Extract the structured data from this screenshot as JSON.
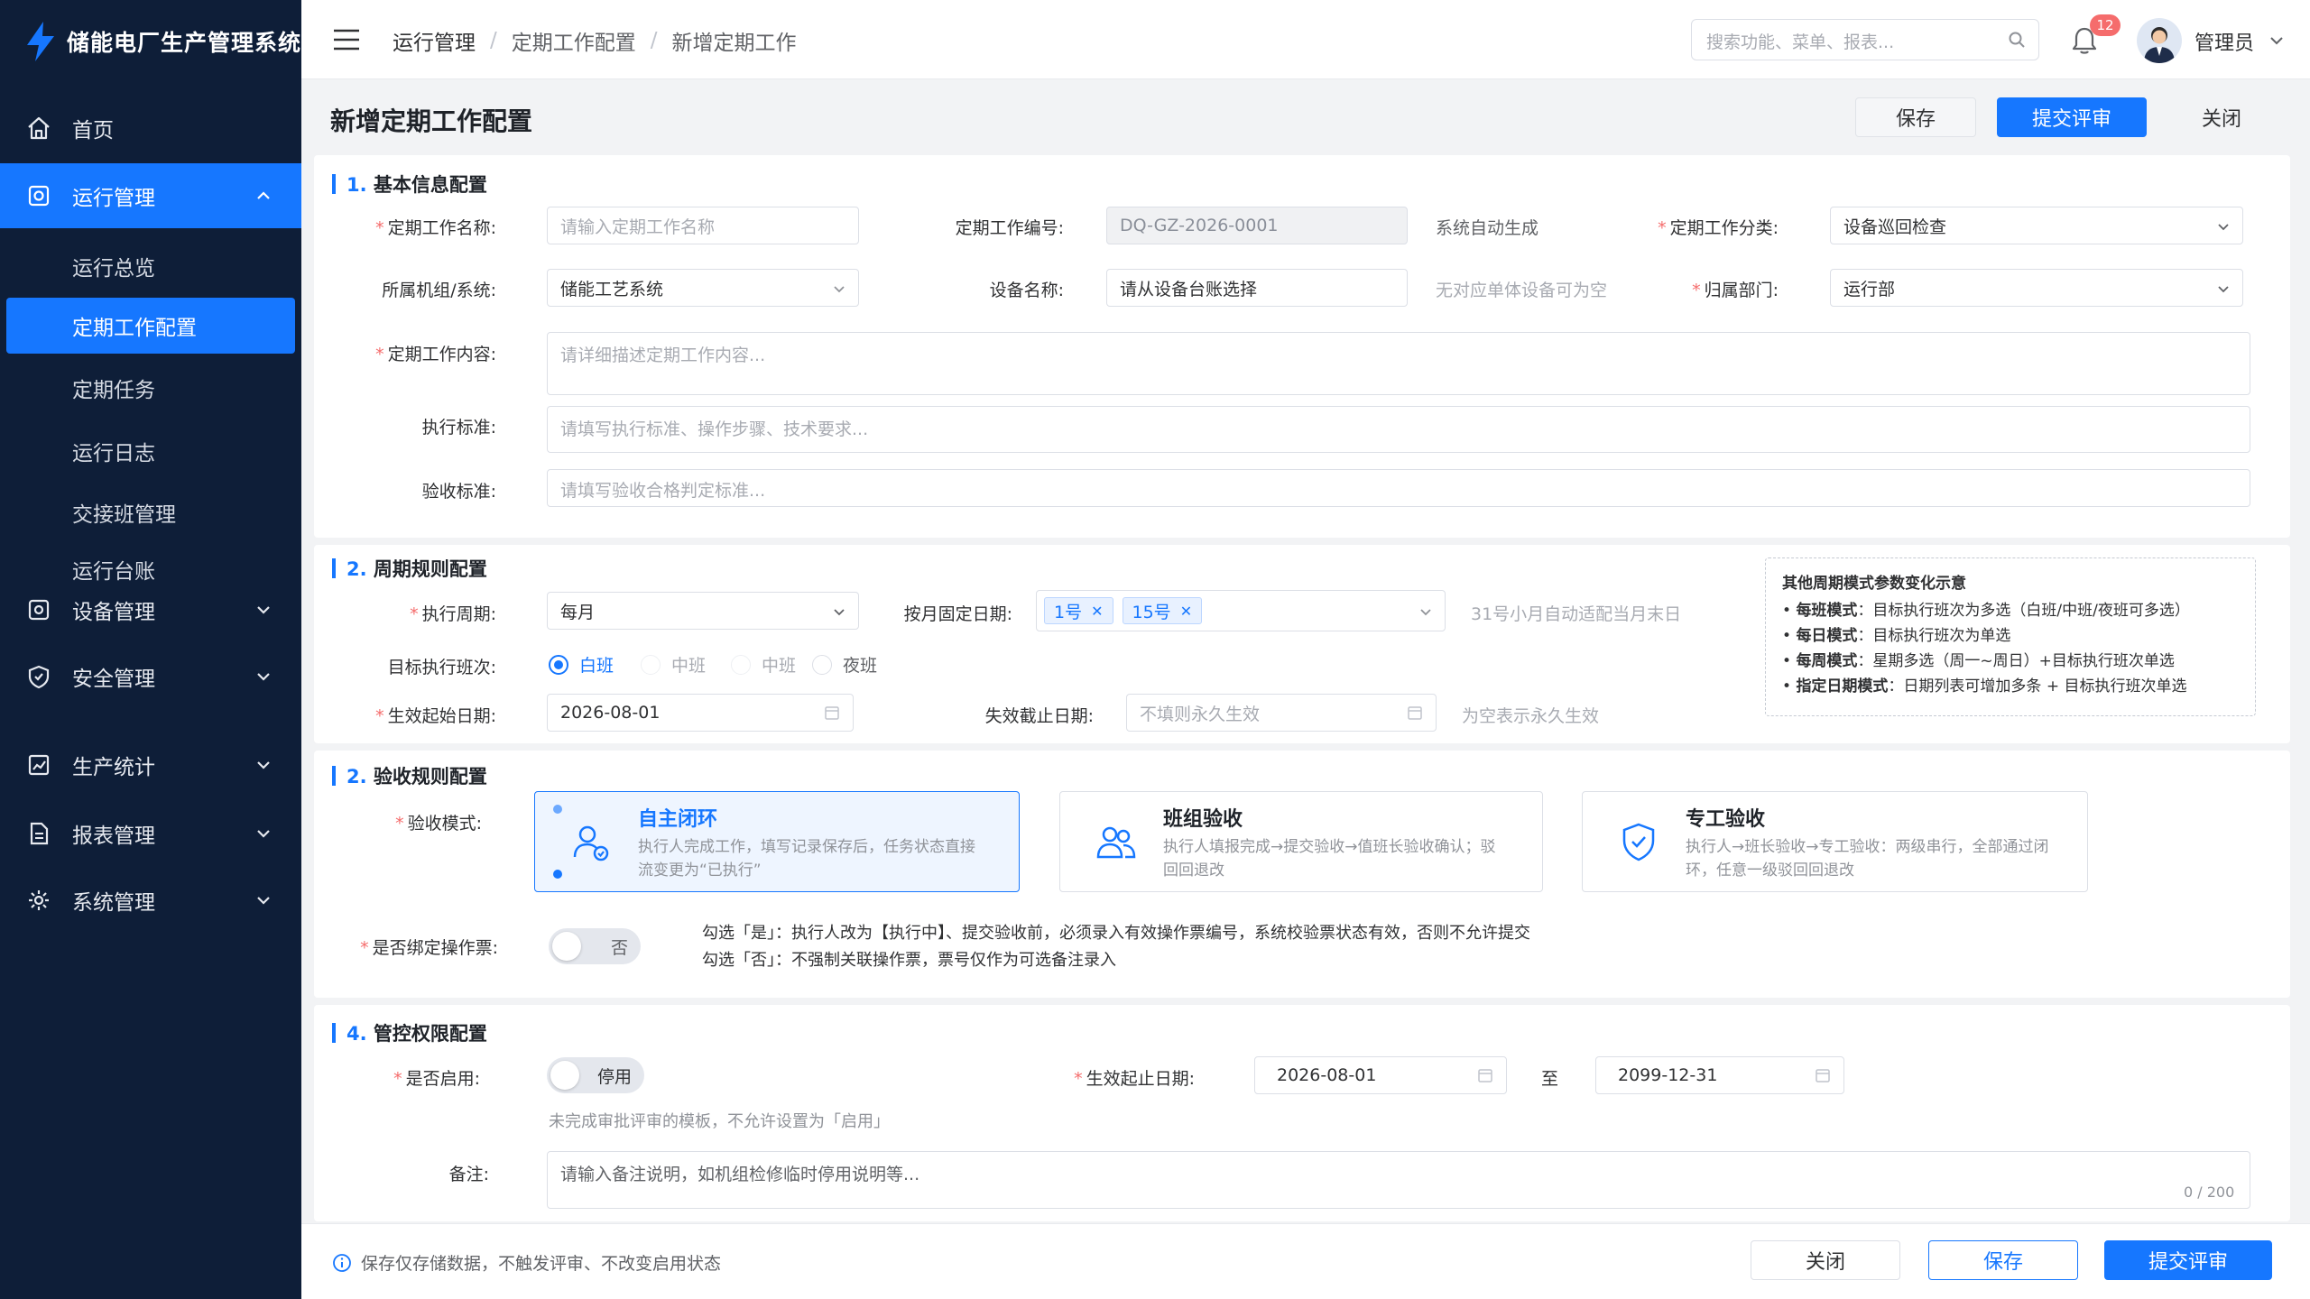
{
  "app": {
    "title": "储能电厂生产管理系统"
  },
  "sidebar": {
    "items": [
      {
        "label": "首页"
      },
      {
        "label": "运行管理"
      },
      {
        "label": "设备管理"
      },
      {
        "label": "安全管理"
      },
      {
        "label": "生产统计"
      },
      {
        "label": "报表管理"
      },
      {
        "label": "系统管理"
      }
    ],
    "sub_items": [
      {
        "label": "运行总览"
      },
      {
        "label": "定期工作配置"
      },
      {
        "label": "定期任务"
      },
      {
        "label": "运行日志"
      },
      {
        "label": "交接班管理"
      },
      {
        "label": "运行台账"
      }
    ]
  },
  "header": {
    "breadcrumb": [
      "运行管理",
      "定期工作配置",
      "新增定期工作"
    ],
    "search_placeholder": "搜索功能、菜单、报表...",
    "notification_count": "12",
    "username": "管理员"
  },
  "page": {
    "title": "新增定期工作配置",
    "save_label": "保存",
    "submit_label": "提交评审",
    "close_label": "关闭"
  },
  "basic": {
    "title_num": "1.",
    "title": "基本信息配置",
    "name_label": "定期工作名称:",
    "name_placeholder": "请输入定期工作名称",
    "code_label": "定期工作编号:",
    "code_value": "DQ-GZ-2026-0001",
    "code_hint": "系统自动生成",
    "category_label": "定期工作分类:",
    "category_value": "设备巡回检查",
    "system_label": "所属机组/系统:",
    "system_value": "储能工艺系统",
    "device_label": "设备名称:",
    "device_placeholder": "请从设备台账选择",
    "device_hint": "无对应单体设备可为空",
    "dept_label": "归属部门:",
    "dept_value": "运行部",
    "content_label": "定期工作内容:",
    "content_placeholder": "请详细描述定期工作内容...",
    "standard_label": "执行标准:",
    "standard_placeholder": "请填写执行标准、操作步骤、技术要求...",
    "accept_label": "验收标准:",
    "accept_placeholder": "请填写验收合格判定标准..."
  },
  "cycle": {
    "title_num": "2.",
    "title": "周期规则配置",
    "period_label": "执行周期:",
    "period_value": "每月",
    "fixed_date_label": "按月固定日期:",
    "fixed_dates": [
      "1号",
      "15号"
    ],
    "fixed_date_hint": "31号小月自动适配当月末日",
    "shift_label": "目标执行班次:",
    "shifts": [
      "白班",
      "中班",
      "中班",
      "夜班"
    ],
    "start_label": "生效起始日期:",
    "start_value": "2026-08-01",
    "end_label": "失效截止日期:",
    "end_placeholder": "不填则永久生效",
    "end_hint": "为空表示永久生效",
    "note_title": "其他周期模式参数变化示意",
    "notes": [
      {
        "k": "每班模式",
        "v": "：目标执行班次为多选（白班/中班/夜班可多选）"
      },
      {
        "k": "每日模式",
        "v": "：目标执行班次为单选"
      },
      {
        "k": "每周模式",
        "v": "：星期多选（周一~周日）+目标执行班次单选"
      },
      {
        "k": "指定日期模式",
        "v": "：日期列表可增加多条 + 目标执行班次单选"
      }
    ]
  },
  "acceptance": {
    "title_num": "2.",
    "title": "验收规则配置",
    "mode_label": "验收模式:",
    "modes": [
      {
        "title": "自主闭环",
        "desc": "执行人完成工作，填写记录保存后，任务状态直接流变更为“已执行”"
      },
      {
        "title": "班组验收",
        "desc": "执行人填报完成→提交验收→值班长验收确认；驳回回退改"
      },
      {
        "title": "专工验收",
        "desc": "执行人→班长验收→专工验收：两级串行，全部通过闭环，任意一级驳回回退改"
      }
    ],
    "ticket_label": "是否绑定操作票:",
    "ticket_toggle": "否",
    "ticket_desc_1": "勾选「是」：执行人改为【执行中】、提交验收前，必须录入有效操作票编号，系统校验票状态有效，否则不允许提交",
    "ticket_desc_2": "勾选「否」：不强制关联操作票，票号仅作为可选备注录入"
  },
  "control": {
    "title_num": "4.",
    "title": "管控权限配置",
    "enable_label": "是否启用:",
    "enable_toggle": "停用",
    "enable_hint": "未完成审批评审的模板，不允许设置为「启用」",
    "period_label": "生效起止日期:",
    "from_value": "2026-08-01",
    "to_label": "至",
    "to_value": "2099-12-31",
    "remark_label": "备注:",
    "remark_placeholder": "请输入备注说明，如机组检修临时停用说明等...",
    "remark_counter": "0 / 200"
  },
  "footer": {
    "info": "保存仅存储数据，不触发评审、不改变启用状态",
    "close_label": "关闭",
    "save_label": "保存",
    "submit_label": "提交评审"
  }
}
